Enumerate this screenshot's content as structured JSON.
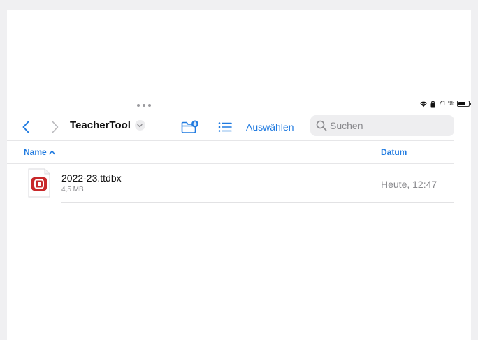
{
  "status": {
    "battery_percent": "71 %",
    "battery_level": 0.71
  },
  "toolbar": {
    "folder_title": "TeacherTool",
    "select_label": "Auswählen",
    "search_placeholder": "Suchen"
  },
  "columns": {
    "name": "Name",
    "date": "Datum"
  },
  "files": [
    {
      "name": "2022-23.ttdbx",
      "size": "4,5 MB",
      "date": "Heute, 12:47"
    }
  ],
  "colors": {
    "accent": "#1f7ae0",
    "file_icon_red": "#c8282a"
  }
}
